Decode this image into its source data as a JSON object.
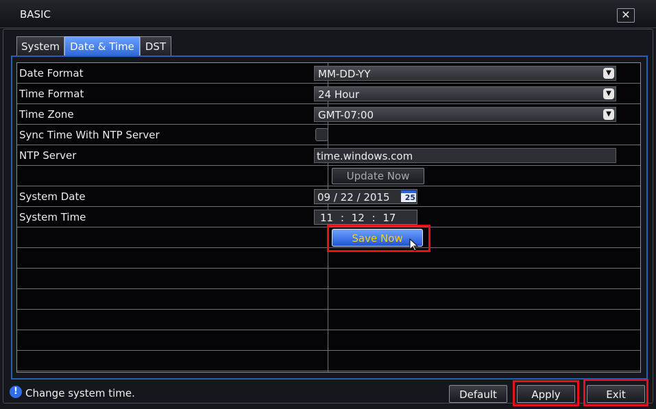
{
  "window": {
    "title": "BASIC",
    "close_icon": "close-icon"
  },
  "tabs": [
    {
      "label": "System",
      "active": false
    },
    {
      "label": "Date & Time",
      "active": true
    },
    {
      "label": "DST",
      "active": false
    }
  ],
  "settings": {
    "date_format": {
      "label": "Date Format",
      "value": "MM-DD-YY"
    },
    "time_format": {
      "label": "Time Format",
      "value": "24 Hour"
    },
    "time_zone": {
      "label": "Time Zone",
      "value": "GMT-07:00"
    },
    "ntp_sync": {
      "label": "Sync Time With NTP Server",
      "checked": false
    },
    "ntp_server": {
      "label": "NTP Server",
      "value": "time.windows.com"
    },
    "update_now_label": "Update Now",
    "system_date": {
      "label": "System Date",
      "value": "09 / 22 / 2015",
      "calendar_icon_text": "25"
    },
    "system_time": {
      "label": "System Time",
      "value": "11 : 12 : 17"
    },
    "save_now_label": "Save Now"
  },
  "status": {
    "icon": "info-icon",
    "text": "Change system time."
  },
  "footer": {
    "default_label": "Default",
    "apply_label": "Apply",
    "exit_label": "Exit"
  },
  "colors": {
    "accent": "#2d66d8",
    "highlight": "#e8101a",
    "save_text": "#ffd400"
  }
}
